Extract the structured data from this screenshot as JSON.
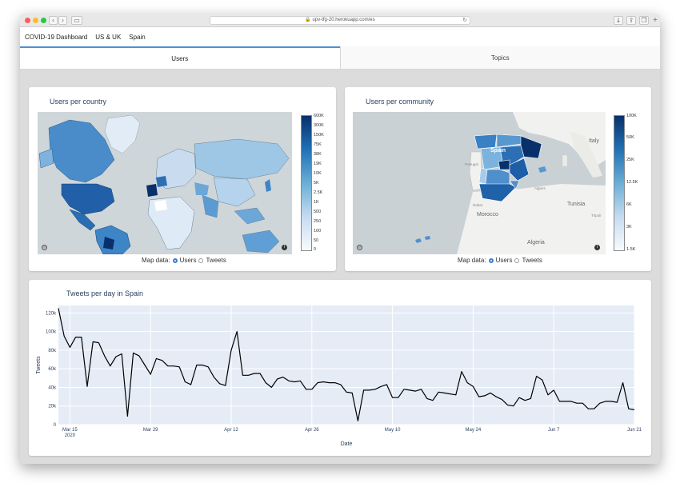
{
  "browser": {
    "url": "upv-tfg-20.herokuapp.com/es"
  },
  "navbar": {
    "items": [
      "COVID-19 Dashboard",
      "US & UK",
      "Spain"
    ]
  },
  "tabs": [
    {
      "label": "Users",
      "active": true
    },
    {
      "label": "Topics",
      "active": false
    }
  ],
  "country_map": {
    "title": "Users per country",
    "colorbar_ticks": [
      "600K",
      "300K",
      "150K",
      "75K",
      "38K",
      "19K",
      "10K",
      "5K",
      "2.5K",
      "1K",
      "500",
      "250",
      "100",
      "50",
      "0"
    ],
    "control_label": "Map data:",
    "options": [
      "Users",
      "Tweets"
    ],
    "selected": "Users"
  },
  "community_map": {
    "title": "Users per community",
    "colorbar_ticks": [
      "100K",
      "50K",
      "25K",
      "12.5K",
      "6K",
      "3K",
      "1.5K"
    ],
    "place_labels": {
      "spain": "Spain",
      "portugal": "Portugal",
      "italy": "Italy",
      "morocco": "Morocco",
      "tunisia": "Tunisia",
      "algeria": "Algeria",
      "algiers": "Algiers",
      "rabat": "Rabat",
      "tripoli": "Tripoli"
    },
    "control_label": "Map data:",
    "options": [
      "Users",
      "Tweets"
    ],
    "selected": "Users"
  },
  "colors": {
    "accent": "#3a7bd5",
    "line": "#000000",
    "plot_bg": "#e5ecf6",
    "map_dark": "#08306b",
    "map_light": "#f7fbff"
  },
  "chart_data": {
    "type": "line",
    "title": "Tweets per day in Spain",
    "xlabel": "Date",
    "ylabel": "Tweets",
    "ylim": [
      0,
      128000
    ],
    "x_range": [
      "2020-03-13",
      "2020-06-21"
    ],
    "yticks": [
      {
        "value": 0,
        "label": "0"
      },
      {
        "value": 20000,
        "label": "20k"
      },
      {
        "value": 40000,
        "label": "40k"
      },
      {
        "value": 60000,
        "label": "60k"
      },
      {
        "value": 80000,
        "label": "80k"
      },
      {
        "value": 100000,
        "label": "100k"
      },
      {
        "value": 120000,
        "label": "120k"
      }
    ],
    "xticks": [
      {
        "date": "2020-03-15",
        "label": "Mar 15",
        "sub": "2020"
      },
      {
        "date": "2020-03-29",
        "label": "Mar 29",
        "sub": ""
      },
      {
        "date": "2020-04-12",
        "label": "Apr 12",
        "sub": ""
      },
      {
        "date": "2020-04-26",
        "label": "Apr 26",
        "sub": ""
      },
      {
        "date": "2020-05-10",
        "label": "May 10",
        "sub": ""
      },
      {
        "date": "2020-05-24",
        "label": "May 24",
        "sub": ""
      },
      {
        "date": "2020-06-07",
        "label": "Jun 7",
        "sub": ""
      },
      {
        "date": "2020-06-21",
        "label": "Jun 21",
        "sub": ""
      }
    ],
    "series": [
      {
        "values": [
          [
            "2020-03-13",
            125000
          ],
          [
            "2020-03-14",
            95000
          ],
          [
            "2020-03-15",
            83000
          ],
          [
            "2020-03-16",
            94000
          ],
          [
            "2020-03-17",
            94000
          ],
          [
            "2020-03-18",
            41000
          ],
          [
            "2020-03-19",
            89000
          ],
          [
            "2020-03-20",
            88000
          ],
          [
            "2020-03-21",
            74000
          ],
          [
            "2020-03-22",
            63000
          ],
          [
            "2020-03-23",
            73000
          ],
          [
            "2020-03-24",
            76000
          ],
          [
            "2020-03-25",
            9000
          ],
          [
            "2020-03-26",
            77000
          ],
          [
            "2020-03-27",
            74000
          ],
          [
            "2020-03-28",
            64000
          ],
          [
            "2020-03-29",
            54000
          ],
          [
            "2020-03-30",
            71000
          ],
          [
            "2020-03-31",
            69000
          ],
          [
            "2020-04-01",
            63000
          ],
          [
            "2020-04-02",
            63000
          ],
          [
            "2020-04-03",
            62000
          ],
          [
            "2020-04-04",
            46000
          ],
          [
            "2020-04-05",
            43000
          ],
          [
            "2020-04-06",
            64000
          ],
          [
            "2020-04-07",
            64000
          ],
          [
            "2020-04-08",
            62000
          ],
          [
            "2020-04-09",
            51000
          ],
          [
            "2020-04-10",
            44000
          ],
          [
            "2020-04-11",
            42000
          ],
          [
            "2020-04-12",
            80000
          ],
          [
            "2020-04-13",
            100000
          ],
          [
            "2020-04-14",
            53000
          ],
          [
            "2020-04-15",
            53000
          ],
          [
            "2020-04-16",
            55000
          ],
          [
            "2020-04-17",
            55000
          ],
          [
            "2020-04-18",
            45000
          ],
          [
            "2020-04-19",
            40000
          ],
          [
            "2020-04-20",
            49000
          ],
          [
            "2020-04-21",
            51000
          ],
          [
            "2020-04-22",
            47000
          ],
          [
            "2020-04-23",
            46000
          ],
          [
            "2020-04-24",
            47000
          ],
          [
            "2020-04-25",
            38000
          ],
          [
            "2020-04-26",
            38000
          ],
          [
            "2020-04-27",
            45000
          ],
          [
            "2020-04-28",
            46000
          ],
          [
            "2020-04-29",
            45000
          ],
          [
            "2020-04-30",
            45000
          ],
          [
            "2020-05-01",
            43000
          ],
          [
            "2020-05-02",
            35000
          ],
          [
            "2020-05-03",
            34000
          ],
          [
            "2020-05-04",
            4000
          ],
          [
            "2020-05-05",
            37000
          ],
          [
            "2020-05-06",
            37000
          ],
          [
            "2020-05-07",
            38000
          ],
          [
            "2020-05-08",
            41000
          ],
          [
            "2020-05-09",
            43000
          ],
          [
            "2020-05-10",
            29000
          ],
          [
            "2020-05-11",
            29000
          ],
          [
            "2020-05-12",
            38000
          ],
          [
            "2020-05-13",
            37000
          ],
          [
            "2020-05-14",
            36000
          ],
          [
            "2020-05-15",
            38000
          ],
          [
            "2020-05-16",
            28000
          ],
          [
            "2020-05-17",
            26000
          ],
          [
            "2020-05-18",
            35000
          ],
          [
            "2020-05-19",
            34000
          ],
          [
            "2020-05-20",
            33000
          ],
          [
            "2020-05-21",
            32000
          ],
          [
            "2020-05-22",
            57000
          ],
          [
            "2020-05-23",
            45000
          ],
          [
            "2020-05-24",
            41000
          ],
          [
            "2020-05-25",
            30000
          ],
          [
            "2020-05-26",
            31000
          ],
          [
            "2020-05-27",
            34000
          ],
          [
            "2020-05-28",
            30000
          ],
          [
            "2020-05-29",
            27000
          ],
          [
            "2020-05-30",
            21000
          ],
          [
            "2020-05-31",
            20000
          ],
          [
            "2020-06-01",
            29000
          ],
          [
            "2020-06-02",
            26000
          ],
          [
            "2020-06-03",
            28000
          ],
          [
            "2020-06-04",
            52000
          ],
          [
            "2020-06-05",
            48000
          ],
          [
            "2020-06-06",
            32000
          ],
          [
            "2020-06-07",
            37000
          ],
          [
            "2020-06-08",
            25000
          ],
          [
            "2020-06-09",
            25000
          ],
          [
            "2020-06-10",
            25000
          ],
          [
            "2020-06-11",
            23000
          ],
          [
            "2020-06-12",
            23000
          ],
          [
            "2020-06-13",
            17000
          ],
          [
            "2020-06-14",
            17000
          ],
          [
            "2020-06-15",
            23000
          ],
          [
            "2020-06-16",
            25000
          ],
          [
            "2020-06-17",
            25000
          ],
          [
            "2020-06-18",
            24000
          ],
          [
            "2020-06-19",
            45000
          ],
          [
            "2020-06-20",
            17000
          ],
          [
            "2020-06-21",
            16000
          ]
        ]
      }
    ]
  }
}
